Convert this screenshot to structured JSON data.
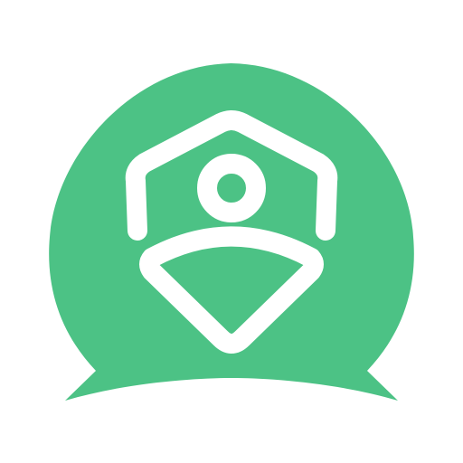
{
  "icon": {
    "name": "user-shield-chat-icon",
    "colors": {
      "background": "#ffffff",
      "bubble": "#4cc285",
      "glyph": "#ffffff"
    }
  }
}
